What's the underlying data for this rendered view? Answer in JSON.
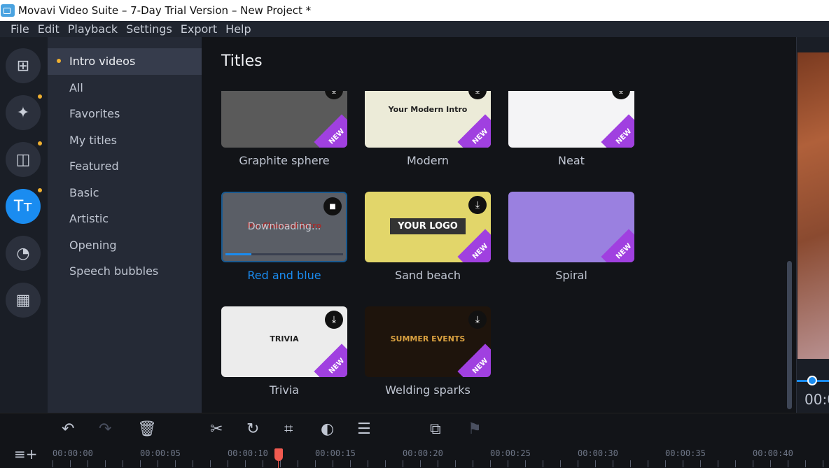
{
  "window": {
    "title": "Movavi Video Suite – 7-Day Trial Version – New Project *"
  },
  "menu": [
    "File",
    "Edit",
    "Playback",
    "Settings",
    "Export",
    "Help"
  ],
  "rail": [
    {
      "icon": "import-folder-icon",
      "active": false,
      "dot": false
    },
    {
      "icon": "magic-wand-icon",
      "active": false,
      "dot": true
    },
    {
      "icon": "transitions-icon",
      "active": false,
      "dot": true
    },
    {
      "icon": "titles-icon",
      "active": true,
      "dot": true
    },
    {
      "icon": "stickers-icon",
      "active": false,
      "dot": false
    },
    {
      "icon": "more-tools-icon",
      "active": false,
      "dot": false
    }
  ],
  "categories": [
    "Intro videos",
    "All",
    "Favorites",
    "My titles",
    "Featured",
    "Basic",
    "Artistic",
    "Opening",
    "Speech bubbles"
  ],
  "main": {
    "heading": "Titles",
    "new_badge": "NEW",
    "downloading_text": "Downloading...",
    "download_progress": 0.22,
    "tiles": [
      {
        "label": "Graphite sphere",
        "bg": "#5a5a5a",
        "state": "download"
      },
      {
        "label": "Modern",
        "bg": "#ecebd8",
        "state": "download",
        "text": "Your Modern Intro"
      },
      {
        "label": "Neat",
        "bg": "#f4f4f6",
        "state": "download"
      },
      {
        "label": "Red and blue",
        "bg": "#5a5e66",
        "state": "downloading",
        "text": "My Channel Intro"
      },
      {
        "label": "Sand beach",
        "bg": "#e2d66a",
        "state": "download",
        "text": "YOUR LOGO"
      },
      {
        "label": "Spiral",
        "bg": "#9a80e0",
        "state": "none"
      },
      {
        "label": "Trivia",
        "bg": "#ececec",
        "state": "download",
        "text": "TRIVIA"
      },
      {
        "label": "Welding sparks",
        "bg": "#1e140c",
        "state": "download",
        "text": "SUMMER EVENTS"
      }
    ]
  },
  "preview": {
    "time": "00:0"
  },
  "toolbar": [
    "undo-icon",
    "redo-icon",
    "delete-icon",
    "cut-icon",
    "rotate-icon",
    "crop-icon",
    "color-adjust-icon",
    "settings-sliders-icon",
    "overlay-icon",
    "marker-flag-icon"
  ],
  "timeline": {
    "labels": [
      "00:00:00",
      "00:00:05",
      "00:00:10",
      "00:00:15",
      "00:00:20",
      "00:00:25",
      "00:00:30",
      "00:00:35",
      "00:00:40"
    ],
    "playhead_seconds": 12.9
  },
  "colors": {
    "accent": "#1a8cf0",
    "new_badge": "#a040e0",
    "playhead": "#f05a50",
    "dot": "#f0b030"
  }
}
